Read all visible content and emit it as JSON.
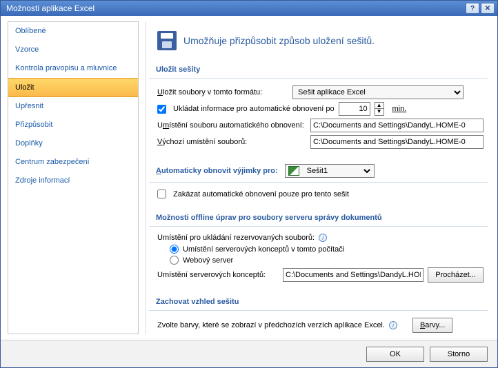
{
  "title": "Možnosti aplikace Excel",
  "sidebar": {
    "items": [
      {
        "label": "Oblíbené"
      },
      {
        "label": "Vzorce"
      },
      {
        "label": "Kontrola pravopisu a mluvnice"
      },
      {
        "label": "Uložit"
      },
      {
        "label": "Upřesnit"
      },
      {
        "label": "Přizpůsobit"
      },
      {
        "label": "Doplňky"
      },
      {
        "label": "Centrum zabezpečení"
      },
      {
        "label": "Zdroje informací"
      }
    ],
    "selected_index": 3
  },
  "hero_text": "Umožňuje přizpůsobit způsob uložení sešitů.",
  "save": {
    "heading": "Uložit sešity",
    "format_label": "Uložit soubory v tomto formátu:",
    "format_value": "Sešit aplikace Excel",
    "autorecover_label": "Ukládat informace pro automatické obnovení po",
    "autorecover_minutes": "10",
    "min_label": "min.",
    "autorecover_loc_label": "Umístění souboru automatického obnovení:",
    "autorecover_loc_value": "C:\\Documents and Settings\\DandyL.HOME-0",
    "default_loc_label": "Výchozí umístění souborů:",
    "default_loc_value": "C:\\Documents and Settings\\DandyL.HOME-0"
  },
  "exceptions": {
    "heading": "Automaticky obnovit výjimky pro:",
    "workbook": "Sešit1",
    "disable_label": "Zakázat automatické obnovení pouze pro tento sešit"
  },
  "offline": {
    "heading": "Možnosti offline úprav pro soubory serveru správy dokumentů",
    "loc_label": "Umístění pro ukládání rezervovaných souborů:",
    "radio1": "Umístění serverových konceptů v tomto počítači",
    "radio2": "Webový server",
    "drafts_label": "Umístění serverových konceptů:",
    "drafts_value": "C:\\Documents and Settings\\DandyL.HOI",
    "browse_btn": "Procházet..."
  },
  "appearance": {
    "heading": "Zachovat vzhled sešitu",
    "desc": "Zvolte barvy, které se zobrazí v předchozích verzích aplikace Excel.",
    "colors_btn": "Barvy..."
  },
  "footer": {
    "ok": "OK",
    "cancel": "Storno"
  }
}
